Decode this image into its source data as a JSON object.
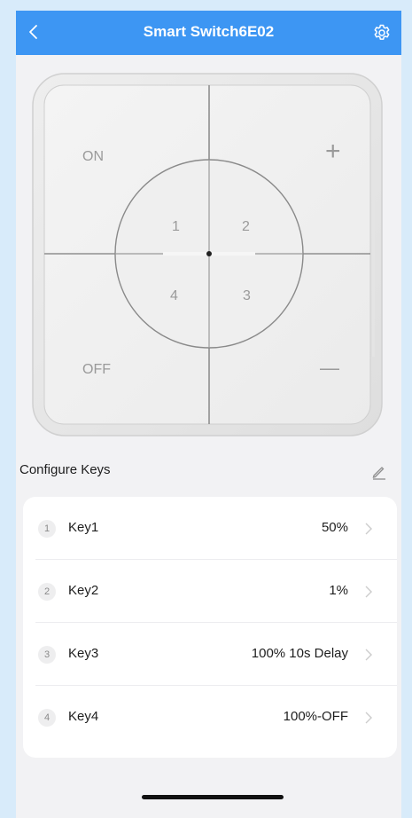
{
  "header": {
    "title": "Smart Switch6E02",
    "back_icon": "chevron-left-icon",
    "settings_icon": "gear-icon",
    "background": "#3d96f3"
  },
  "panel": {
    "on_label": "ON",
    "off_label": "OFF",
    "plus_label": "+",
    "minus_label": "—",
    "keys": [
      "1",
      "2",
      "3",
      "4"
    ]
  },
  "configure": {
    "title": "Configure Keys",
    "edit_icon": "pencil-icon"
  },
  "keys": [
    {
      "num": "1",
      "name": "Key1",
      "value": "50%"
    },
    {
      "num": "2",
      "name": "Key2",
      "value": "1%"
    },
    {
      "num": "3",
      "name": "Key3",
      "value": "100% 10s Delay"
    },
    {
      "num": "4",
      "name": "Key4",
      "value": "100%-OFF"
    }
  ]
}
